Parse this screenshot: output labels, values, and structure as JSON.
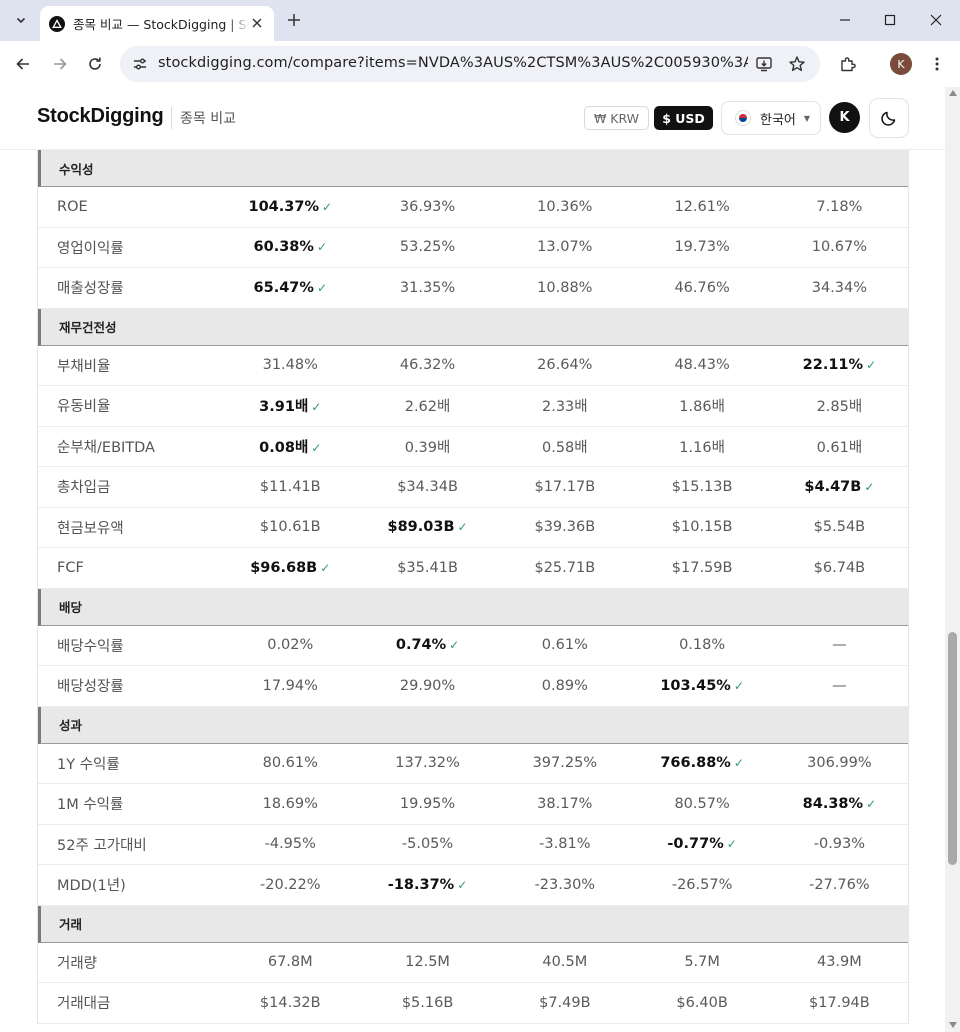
{
  "browser": {
    "tab_title": "종목 비교 — StockDigging | St",
    "url": "stockdigging.com/compare?items=NVDA%3AUS%2CTSM%3AUS%2C005930%3AKR%2C00...",
    "profile_initial": "K"
  },
  "header": {
    "logo": "StockDigging",
    "subtitle": "종목 비교",
    "currency_krw": "₩ KRW",
    "currency_usd": "$ USD",
    "language": "한국어",
    "user_initial": "K"
  },
  "table": {
    "sections": [
      {
        "title": "수익성",
        "rows": [
          {
            "label": "ROE",
            "values": [
              "104.37%",
              "36.93%",
              "10.36%",
              "12.61%",
              "7.18%"
            ],
            "best": 0
          },
          {
            "label": "영업이익률",
            "values": [
              "60.38%",
              "53.25%",
              "13.07%",
              "19.73%",
              "10.67%"
            ],
            "best": 0
          },
          {
            "label": "매출성장률",
            "values": [
              "65.47%",
              "31.35%",
              "10.88%",
              "46.76%",
              "34.34%"
            ],
            "best": 0
          }
        ]
      },
      {
        "title": "재무건전성",
        "rows": [
          {
            "label": "부채비율",
            "values": [
              "31.48%",
              "46.32%",
              "26.64%",
              "48.43%",
              "22.11%"
            ],
            "best": 4
          },
          {
            "label": "유동비율",
            "values": [
              "3.91배",
              "2.62배",
              "2.33배",
              "1.86배",
              "2.85배"
            ],
            "best": 0
          },
          {
            "label": "순부채/EBITDA",
            "values": [
              "0.08배",
              "0.39배",
              "0.58배",
              "1.16배",
              "0.61배"
            ],
            "best": 0
          },
          {
            "label": "총차입금",
            "values": [
              "$11.41B",
              "$34.34B",
              "$17.17B",
              "$15.13B",
              "$4.47B"
            ],
            "best": 4
          },
          {
            "label": "현금보유액",
            "values": [
              "$10.61B",
              "$89.03B",
              "$39.36B",
              "$10.15B",
              "$5.54B"
            ],
            "best": 1
          },
          {
            "label": "FCF",
            "values": [
              "$96.68B",
              "$35.41B",
              "$25.71B",
              "$17.59B",
              "$6.74B"
            ],
            "best": 0
          }
        ]
      },
      {
        "title": "배당",
        "rows": [
          {
            "label": "배당수익률",
            "values": [
              "0.02%",
              "0.74%",
              "0.61%",
              "0.18%",
              "—"
            ],
            "best": 1
          },
          {
            "label": "배당성장률",
            "values": [
              "17.94%",
              "29.90%",
              "0.89%",
              "103.45%",
              "—"
            ],
            "best": 3
          }
        ]
      },
      {
        "title": "성과",
        "rows": [
          {
            "label": "1Y 수익률",
            "values": [
              "80.61%",
              "137.32%",
              "397.25%",
              "766.88%",
              "306.99%"
            ],
            "best": 3
          },
          {
            "label": "1M 수익률",
            "values": [
              "18.69%",
              "19.95%",
              "38.17%",
              "80.57%",
              "84.38%"
            ],
            "best": 4
          },
          {
            "label": "52주 고가대비",
            "values": [
              "-4.95%",
              "-5.05%",
              "-3.81%",
              "-0.77%",
              "-0.93%"
            ],
            "best": 3
          },
          {
            "label": "MDD(1년)",
            "values": [
              "-20.22%",
              "-18.37%",
              "-23.30%",
              "-26.57%",
              "-27.76%"
            ],
            "best": 1
          }
        ]
      },
      {
        "title": "거래",
        "rows": [
          {
            "label": "거래량",
            "values": [
              "67.8M",
              "12.5M",
              "40.5M",
              "5.7M",
              "43.9M"
            ],
            "best": -1
          },
          {
            "label": "거래대금",
            "values": [
              "$14.32B",
              "$5.16B",
              "$7.49B",
              "$6.40B",
              "$17.94B"
            ],
            "best": -1
          }
        ]
      }
    ],
    "best_mark": "✓",
    "colors": {
      "check": "#2e9d6a",
      "best_text": "#111111",
      "normal_text": "#5a5a5a",
      "section_bg": "#e8e8e8"
    }
  }
}
